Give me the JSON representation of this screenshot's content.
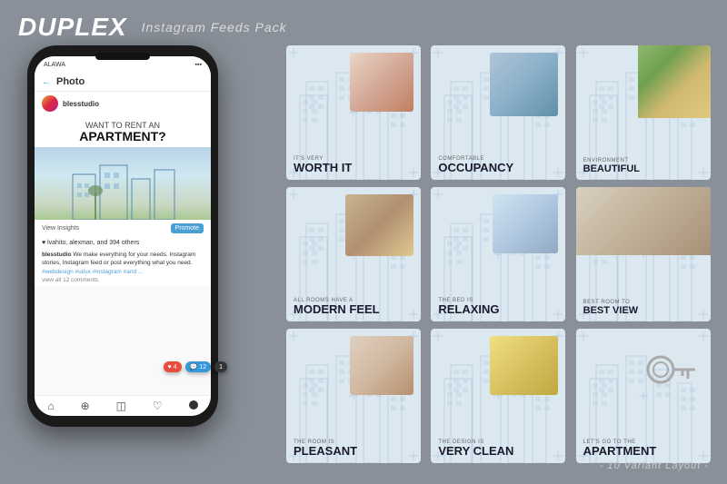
{
  "brand": {
    "title": "DUPLEX",
    "subtitle": "Instagram Feeds Pack"
  },
  "phone": {
    "status": "ALAWA",
    "back_label": "Photo",
    "username": "blesstudio",
    "post_small": "WANT TO RENT AN",
    "post_big": "APARTMENT?",
    "view_insights": "View Insights",
    "promote": "Promote",
    "likes_text": "♥ lvahito, alexman, and 394 others",
    "caption_user": "blesstudio",
    "caption_text": "We make everything for your needs. Instagram stories, Instagram feed or post everything what you need.",
    "hashtags": "#webdesign #ui/ux #instagram #and ...",
    "view_comments": "view all 12 comments",
    "notif1": "4",
    "notif2": "12",
    "notif3": "1"
  },
  "posts": [
    {
      "label_small": "IT'S VERY",
      "label_big": "WORTH IT",
      "photo_class": "photo-room1",
      "photo_pos": "top-right"
    },
    {
      "label_small": "COMFORTABLE",
      "label_big": "OCCUPANCY",
      "photo_class": "photo-room2",
      "photo_pos": "center"
    },
    {
      "label_small": "ENVIRONMENT",
      "label_big": "BEAUTIFUL",
      "photo_class": "photo-room3",
      "photo_pos": "top-right"
    },
    {
      "label_small": "ALL ROOMS HAVE A",
      "label_big": "MODERN FEEL",
      "photo_class": "photo-room4",
      "photo_pos": "top-right"
    },
    {
      "label_small": "THE BED IS",
      "label_big": "RELAXING",
      "photo_class": "photo-room5",
      "photo_pos": "center"
    },
    {
      "label_small": "BEST ROOM TO",
      "label_big": "BEST VIEW",
      "photo_class": "photo-room6",
      "photo_pos": "top"
    },
    {
      "label_small": "THE ROOM IS",
      "label_big": "PLEASANT",
      "photo_class": "photo-room7",
      "photo_pos": "top-right"
    },
    {
      "label_small": "THE DESIGN IS",
      "label_big": "VERY CLEAN",
      "photo_class": "photo-room8",
      "photo_pos": "center"
    },
    {
      "label_small": "LET'S GO TO THE",
      "label_big": "APARTMENT",
      "photo_class": "photo-key",
      "photo_pos": "center"
    }
  ],
  "footer": "- 10 Variant Layout -",
  "colors": {
    "bg": "#8a9099",
    "accent_blue": "#4a9fd5",
    "card_bg": "#e8eef5",
    "text_dark": "#1a1a2e"
  }
}
